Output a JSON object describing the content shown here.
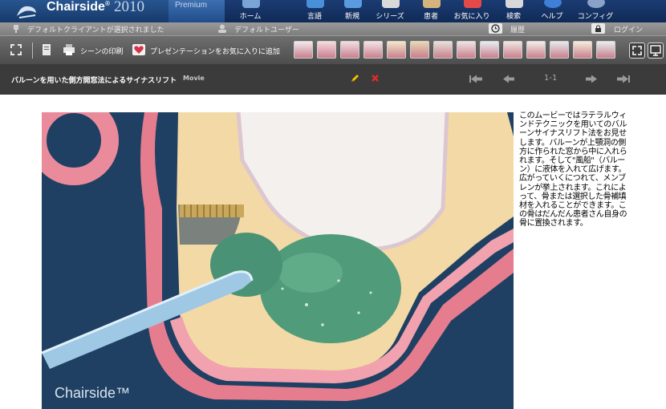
{
  "app": {
    "brand": "Chairside",
    "brand_mark": "®",
    "year": "2010",
    "edition": "Premium"
  },
  "nav": [
    {
      "label": "ホーム",
      "icon": "home-icon",
      "color": "#6f9fd8"
    },
    {
      "label": "言語",
      "icon": "language-icon",
      "color": "#4a90d9"
    },
    {
      "label": "新規",
      "icon": "new-icon",
      "color": "#5a9be0"
    },
    {
      "label": "シリーズ",
      "icon": "series-icon",
      "color": "#d9d9d9"
    },
    {
      "label": "患者",
      "icon": "patient-icon",
      "color": "#d6b37c"
    },
    {
      "label": "お気に入り",
      "icon": "favorites-icon",
      "color": "#e24a4a"
    },
    {
      "label": "検索",
      "icon": "search-icon",
      "color": "#d8d8d8"
    },
    {
      "label": "ヘルプ",
      "icon": "help-icon",
      "color": "#3f7fd8"
    },
    {
      "label": "コンフィグ",
      "icon": "config-icon",
      "color": "#8aa2c8"
    }
  ],
  "status": {
    "client": "デフォルトクライアントが選択されました",
    "user": "デフォルトユーザー",
    "history": "履歴",
    "login": "ログイン"
  },
  "toolbar": {
    "print_label": "シーンの印刷",
    "favorite_label": "プレゼンテーションをお気に入りに追加",
    "thumbnails": [
      "tooth-scene-1",
      "tooth-scene-2",
      "tooth-scene-3",
      "tooth-scene-4",
      "tooth-scene-5",
      "tooth-scene-6",
      "tooth-scene-7",
      "tooth-scene-8",
      "tooth-scene-9",
      "tooth-scene-10",
      "tooth-scene-11",
      "tooth-scene-12",
      "tooth-scene-13",
      "tooth-scene-14"
    ]
  },
  "title_bar": {
    "title": "バルーンを用いた側方開窓法によるサイナスリフト",
    "tag": "Movie",
    "page": "1-1"
  },
  "content": {
    "description": "このムービーではラテラルウィンドテクニックを用いてのバルーンサイナスリフト法をお見せします。バルーンが上顎洞の側方に作られた窓から中に入れられます。そして\"風船\"（バルーン）に液体を入れて広げます。広がっていくにつれて、メンブレンが挙上されます。これによって、骨または選択した骨補填材を入れることができます。この骨はだんだん患者さん自身の骨に置換されます。",
    "watermark": "Chairside™"
  }
}
